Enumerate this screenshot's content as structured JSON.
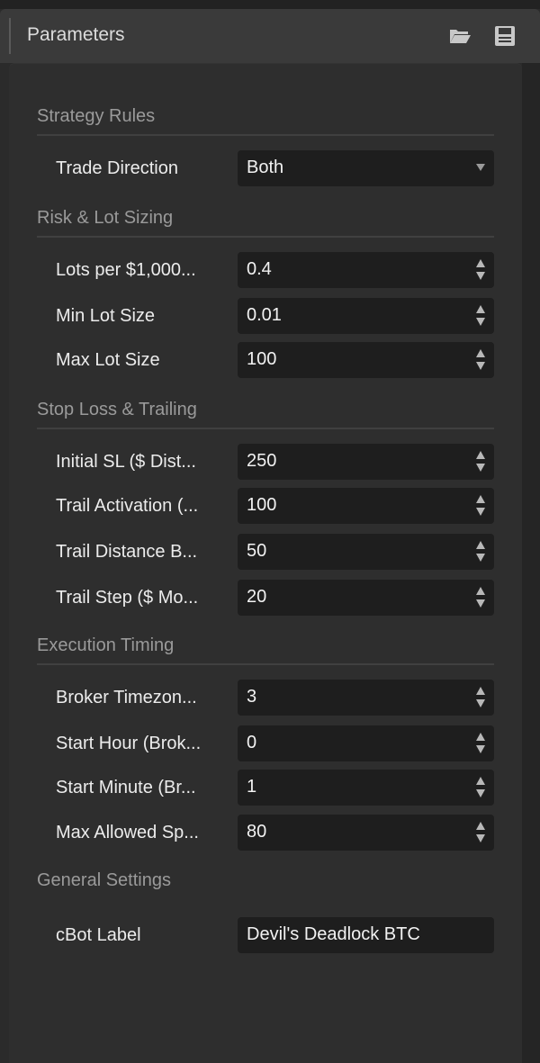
{
  "header": {
    "title": "Parameters",
    "open_icon": "folder-open-icon",
    "save_icon": "save-icon"
  },
  "sections": [
    {
      "title": "Strategy Rules",
      "rows": [
        {
          "label": "Trade Direction",
          "value": "Both",
          "control": "dropdown"
        }
      ]
    },
    {
      "title": "Risk & Lot Sizing",
      "rows": [
        {
          "label": "Lots per $1,000...",
          "value": "0.4",
          "control": "stepper"
        },
        {
          "label": "Min Lot Size",
          "value": "0.01",
          "control": "stepper"
        },
        {
          "label": "Max Lot Size",
          "value": "100",
          "control": "stepper"
        }
      ]
    },
    {
      "title": "Stop Loss & Trailing",
      "rows": [
        {
          "label": "Initial SL ($ Dist...",
          "value": "250",
          "control": "stepper"
        },
        {
          "label": "Trail Activation (...",
          "value": "100",
          "control": "stepper"
        },
        {
          "label": "Trail Distance B...",
          "value": "50",
          "control": "stepper"
        },
        {
          "label": "Trail Step ($ Mo...",
          "value": "20",
          "control": "stepper"
        }
      ]
    },
    {
      "title": "Execution Timing",
      "rows": [
        {
          "label": "Broker Timezon...",
          "value": "3",
          "control": "stepper"
        },
        {
          "label": "Start Hour (Brok...",
          "value": "0",
          "control": "stepper"
        },
        {
          "label": "Start Minute (Br...",
          "value": "1",
          "control": "stepper"
        },
        {
          "label": "Max Allowed Sp...",
          "value": "80",
          "control": "stepper"
        }
      ]
    },
    {
      "title": "General Settings",
      "rows": [
        {
          "label": "cBot Label",
          "value": "Devil's Deadlock BTC",
          "control": "text"
        }
      ]
    }
  ]
}
